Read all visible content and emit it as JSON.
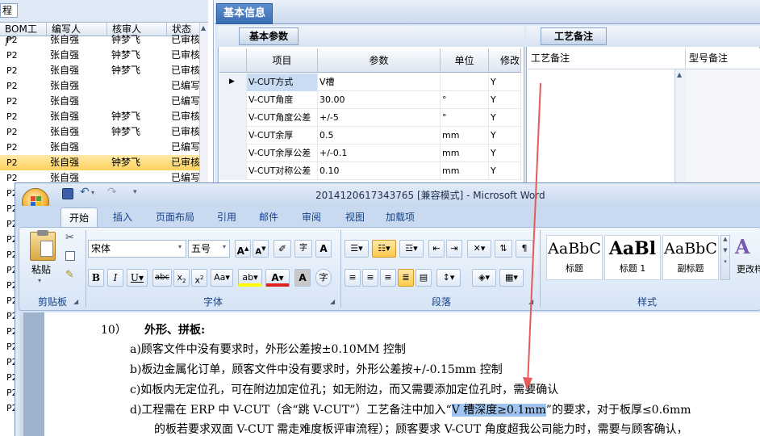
{
  "left_panel": {
    "title_fragment": "程",
    "columns": [
      "BOM工厂",
      "编写人",
      "核审人",
      "状态"
    ],
    "rows": [
      [
        "P2",
        "张自强",
        "钟梦飞",
        "已审核"
      ],
      [
        "P2",
        "张自强",
        "钟梦飞",
        "已审核"
      ],
      [
        "P2",
        "张自强",
        "钟梦飞",
        "已审核"
      ],
      [
        "P2",
        "张自强",
        "",
        "已编写"
      ],
      [
        "P2",
        "张自强",
        "",
        "已编写"
      ],
      [
        "P2",
        "张自强",
        "钟梦飞",
        "已审核"
      ],
      [
        "P2",
        "张自强",
        "钟梦飞",
        "已审核"
      ],
      [
        "P2",
        "张自强",
        "",
        "已编写"
      ],
      [
        "P2",
        "张自强",
        "钟梦飞",
        "已审核"
      ],
      [
        "P2",
        "张自强",
        "",
        "已编写"
      ],
      [
        "P2",
        "",
        "",
        ""
      ],
      [
        "P2",
        "",
        "",
        ""
      ],
      [
        "P2",
        "",
        "",
        ""
      ],
      [
        "P2",
        "",
        "",
        ""
      ],
      [
        "P2",
        "",
        "",
        ""
      ],
      [
        "P2",
        "",
        "",
        ""
      ],
      [
        "P2",
        "",
        "",
        ""
      ],
      [
        "P2",
        "",
        "",
        ""
      ],
      [
        "P2",
        "",
        "",
        ""
      ],
      [
        "P2",
        "",
        "",
        ""
      ],
      [
        "P2",
        "",
        "",
        ""
      ],
      [
        "P2",
        "",
        "",
        ""
      ],
      [
        "P2",
        "",
        "",
        ""
      ],
      [
        "P2",
        "",
        "",
        ""
      ],
      [
        "P2",
        "",
        "",
        ""
      ]
    ]
  },
  "erp": {
    "main_tab": "基本信息",
    "param_tab": "基本参数",
    "remark_tab": "工艺备注",
    "param_columns": [
      "项目",
      "参数",
      "单位",
      "修改"
    ],
    "params": [
      [
        "V-CUT方式",
        "V槽",
        "",
        "Y"
      ],
      [
        "V-CUT角度",
        "30.00",
        "°",
        "Y"
      ],
      [
        "V-CUT角度公差",
        "+/-5",
        "°",
        "Y"
      ],
      [
        "V-CUT余厚",
        "0.5",
        "mm",
        "Y"
      ],
      [
        "V-CUT余厚公差",
        "+/-0.1",
        "mm",
        "Y"
      ],
      [
        "V-CUT对称公差",
        "0.10",
        "mm",
        "Y"
      ]
    ],
    "remark_columns": [
      "工艺备注",
      "型号备注"
    ]
  },
  "word": {
    "title": "2014120617343765 [兼容模式] - Microsoft Word",
    "tabs": [
      "开始",
      "插入",
      "页面布局",
      "引用",
      "邮件",
      "审阅",
      "视图",
      "加载项"
    ],
    "font_name": "宋体",
    "font_size": "五号",
    "groups": [
      "剪贴板",
      "字体",
      "段落",
      "样式"
    ],
    "paste_label": "粘贴",
    "styles": [
      {
        "preview": "AaBbC",
        "name": "标题"
      },
      {
        "preview": "AaBl",
        "name": "标题 1"
      },
      {
        "preview": "AaBbC",
        "name": "副标题"
      }
    ],
    "change_styles": "更改样",
    "doc": {
      "heading_num": "10）",
      "heading": "外形、拼板:",
      "lines": [
        "a)顾客文件中没有要求时，外形公差按±0.10MM 控制",
        "b)板边金属化订单，顾客文件中没有要求时，外形公差按+/-0.15mm 控制",
        "c)如板内无定位孔，可在附边加定位孔；如无附边，而又需要添加定位孔时，需要确认"
      ],
      "line_d_pre": "d)工程需在 ERP 中 V-CUT（含“跳 V-CUT”）工艺备注中加入“",
      "line_d_hl": "V 槽深度≥0.1mm",
      "line_d_post": "”的要求，对于板厚≤0.6mm",
      "line_e": "的板若要求双面 V-CUT 需走难度板评审流程）；顾客要求 V-CUT 角度超我公司能力时，需要与顾客确认，"
    }
  },
  "colors": {
    "accent": "#4a7fc4",
    "selected_row": "#ffd25c",
    "arrow": "#e85a5a",
    "highlight": "#9fc4f0"
  }
}
